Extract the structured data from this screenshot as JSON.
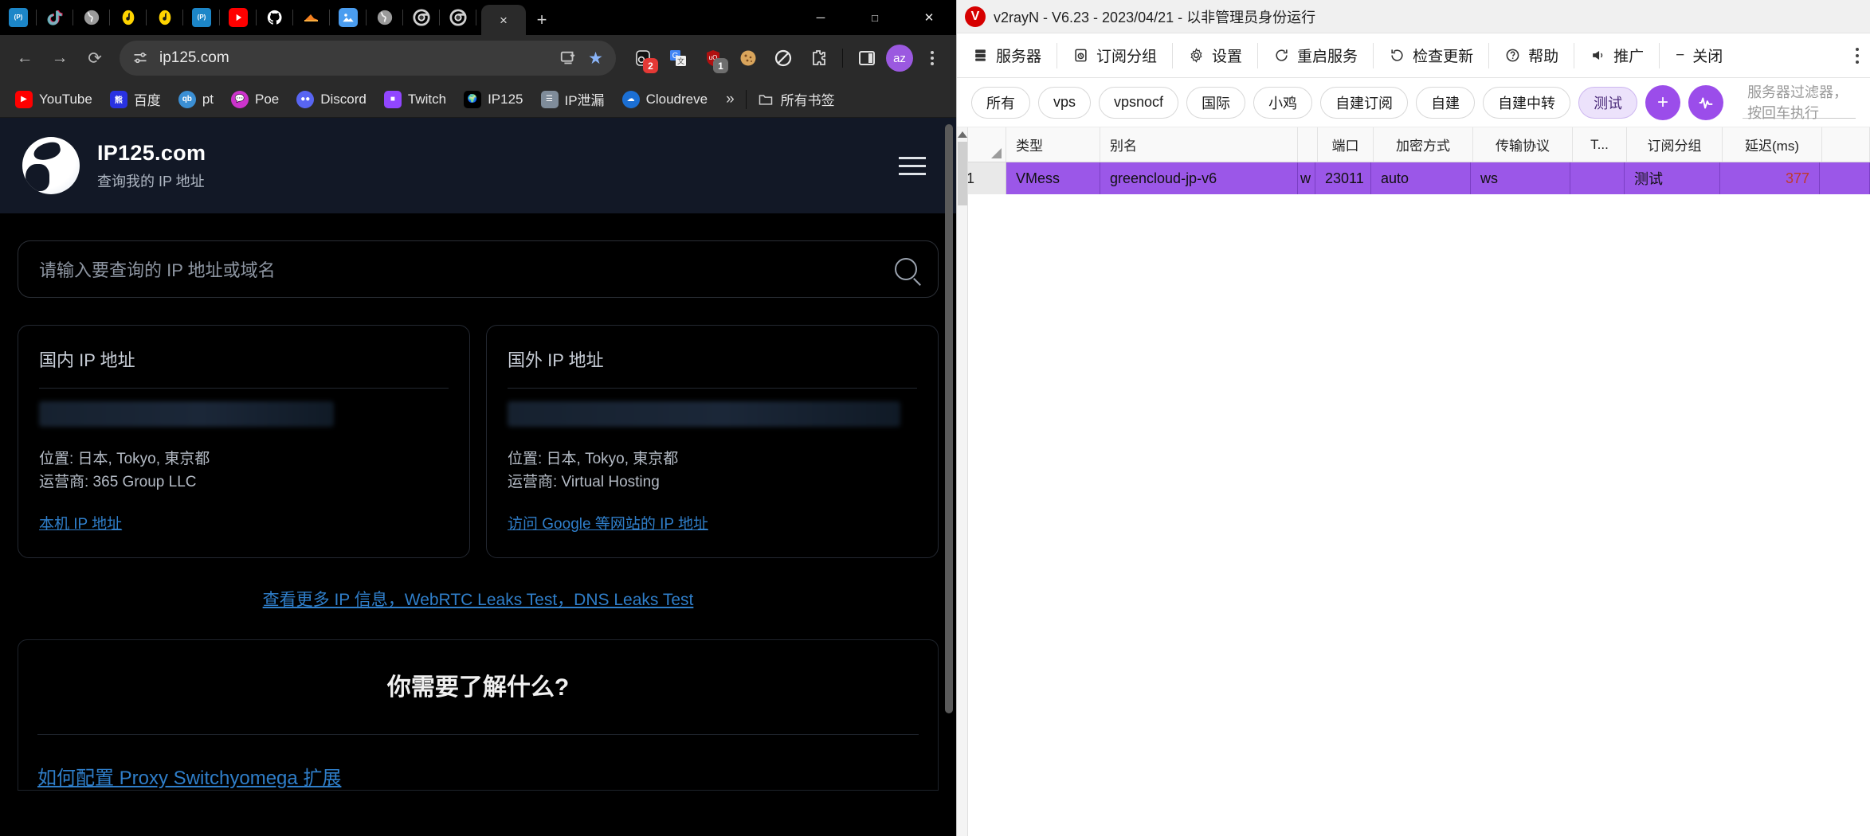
{
  "browser": {
    "tabs_pinned": [
      {
        "icon": "openwrt-icon",
        "name": "tab-openwrt-1"
      },
      {
        "icon": "tiktok-icon",
        "name": "tab-tiktok"
      },
      {
        "icon": "globe-icon",
        "name": "tab-globe-1"
      },
      {
        "icon": "music-icon",
        "name": "tab-music-1"
      },
      {
        "icon": "music-icon",
        "name": "tab-music-2"
      },
      {
        "icon": "openwrt-icon",
        "name": "tab-openwrt-2"
      },
      {
        "icon": "youtube-icon",
        "name": "tab-youtube"
      },
      {
        "icon": "github-icon",
        "name": "tab-github"
      },
      {
        "icon": "cloudflare-icon",
        "name": "tab-cloudflare"
      },
      {
        "icon": "image-icon",
        "name": "tab-image"
      },
      {
        "icon": "globe-icon",
        "name": "tab-globe-2"
      },
      {
        "icon": "chrome-icon",
        "name": "tab-chrome-1"
      },
      {
        "icon": "chrome-icon",
        "name": "tab-chrome-2"
      }
    ],
    "active_tab_close": "×",
    "new_tab": "+",
    "window_controls": {
      "minimize": "─",
      "maximize": "□",
      "close": "✕"
    },
    "nav": {
      "back": "←",
      "forward": "→",
      "reload": "⟳"
    },
    "omnibox": {
      "url": "ip125.com",
      "site_info_icon": "tune-icon",
      "install_icon": "install-app-icon",
      "star_icon": "bookmark-star-icon"
    },
    "extensions": [
      {
        "name": "ext-adblock",
        "label": "◯",
        "badge": "2",
        "badge_color": "#e53935"
      },
      {
        "name": "ext-google-translate",
        "label": "G",
        "badge": "",
        "badge_color": ""
      },
      {
        "name": "ext-ublock-origin",
        "label": "uO",
        "badge": "1",
        "badge_color": "#6e6e6e"
      },
      {
        "name": "ext-cookie-editor",
        "label": "🍪",
        "badge": "",
        "badge_color": ""
      },
      {
        "name": "ext-blocker",
        "label": "⊘",
        "badge": "",
        "badge_color": ""
      },
      {
        "name": "ext-puzzle-extensions",
        "label": "⌘",
        "badge": "",
        "badge_color": ""
      }
    ],
    "sidepanel_icon": "side-panel-icon",
    "profile_avatar": "az",
    "menu_icon": "three-dots-vertical-icon",
    "bookmarks": [
      {
        "label": "YouTube",
        "icon": "youtube-icon",
        "bg": "#ff0000"
      },
      {
        "label": "百度",
        "icon": "baidu-icon",
        "bg": "#2932e1"
      },
      {
        "label": "pt",
        "icon": "qb-icon",
        "bg": "#3b8fd4"
      },
      {
        "label": "Poe",
        "icon": "poe-icon",
        "bg": "#cc33cc"
      },
      {
        "label": "Discord",
        "icon": "discord-icon",
        "bg": "#5865f2"
      },
      {
        "label": "Twitch",
        "icon": "twitch-icon",
        "bg": "#9146ff"
      },
      {
        "label": "IP125",
        "icon": "globe-icon",
        "bg": "#000000"
      },
      {
        "label": "IP泄漏",
        "icon": "server-icon",
        "bg": "#7f8c9a"
      },
      {
        "label": "Cloudreve",
        "icon": "cloudreve-icon",
        "bg": "#1b6fd4"
      }
    ],
    "bookmarks_overflow": "»",
    "all_bookmarks_label": "所有书签",
    "all_bookmarks_icon": "folder-icon"
  },
  "site": {
    "brand_title": "IP125.com",
    "brand_sub": "查询我的 IP 地址",
    "logo_icon": "globe-logo-icon",
    "menu_icon": "hamburger-icon",
    "search_placeholder": "请输入要查询的 IP 地址或域名",
    "search_icon": "magnifier-icon",
    "cards": [
      {
        "title": "国内 IP 地址",
        "ip_value": "",
        "location_label": "位置: 日本, Tokyo, 東京都",
        "isp_label": "运营商: 365 Group LLC",
        "link": "本机 IP 地址"
      },
      {
        "title": "国外 IP 地址",
        "ip_value": "",
        "location_label": "位置: 日本, Tokyo, 東京都",
        "isp_label": "运营商: Virtual Hosting",
        "link": "访问 Google 等网站的 IP 地址"
      }
    ],
    "more_links": "查看更多 IP 信息，WebRTC Leaks Test，DNS Leaks Test",
    "know_title": "你需要了解什么?",
    "know_link": "如何配置 Proxy Switchyomega 扩展"
  },
  "v2ray": {
    "window_title": "v2rayN - V6.23 - 2023/04/21 - 以非管理员身份运行",
    "logo": "V",
    "toolbar": [
      {
        "label": "服务器",
        "icon": "server-icon"
      },
      {
        "label": "订阅分组",
        "icon": "subscription-icon"
      },
      {
        "label": "设置",
        "icon": "gear-icon"
      },
      {
        "label": "重启服务",
        "icon": "restart-icon"
      },
      {
        "label": "检查更新",
        "icon": "refresh-icon"
      },
      {
        "label": "帮助",
        "icon": "help-icon"
      },
      {
        "label": "推广",
        "icon": "megaphone-icon"
      },
      {
        "label": "关闭",
        "icon": "minus-icon"
      }
    ],
    "menu_icon": "three-dots-vertical-icon",
    "filters": [
      "所有",
      "vps",
      "vpsnocf",
      "国际",
      "小鸡",
      "自建订阅",
      "自建",
      "自建中转",
      "测试"
    ],
    "selected_filter": "测试",
    "add_button": "+",
    "speedtest_button_icon": "pulse-icon",
    "filter_placeholder": "服务器过滤器，按回车执行",
    "table": {
      "columns": [
        "",
        "类型",
        "别名",
        "",
        "端口",
        "加密方式",
        "传输协议",
        "T...",
        "订阅分组",
        "延迟(ms)"
      ],
      "rows": [
        {
          "index": "1",
          "type": "VMess",
          "alias": "greencloud-jp-v6",
          "flag": "w",
          "port": "23011",
          "encryption": "auto",
          "transport": "ws",
          "t": "",
          "group": "测试",
          "delay": "377"
        }
      ]
    }
  }
}
